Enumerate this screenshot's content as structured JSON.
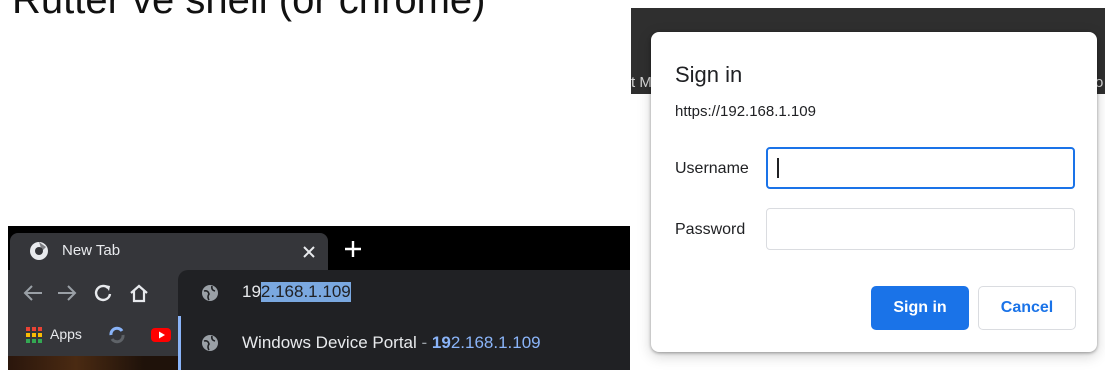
{
  "caption": {
    "text": "Rutter ve shell (or chrome)"
  },
  "browser": {
    "tab": {
      "title": "New Tab",
      "favicon": "chrome-icon",
      "close_icon": "close-icon",
      "new_tab_icon": "plus-icon"
    },
    "toolbar": {
      "icons": [
        "back-arrow-icon",
        "forward-arrow-icon",
        "reload-icon",
        "home-icon"
      ]
    },
    "omnibox": {
      "typed": "19",
      "autocompleted": "2.168.1.109",
      "suggestion": {
        "title": "Windows Device Portal",
        "separator": " - ",
        "match": "19",
        "rest": "2.168.1.109"
      }
    },
    "bookmarks": {
      "apps_label": "Apps",
      "icons": [
        "apps-grid-icon",
        "extension-icon",
        "youtube-icon"
      ]
    }
  },
  "background": {
    "left_text": "t M",
    "right_text": "o"
  },
  "signin": {
    "title": "Sign in",
    "url": "https://192.168.1.109",
    "username_label": "Username",
    "username_value": "",
    "password_label": "Password",
    "password_value": "",
    "sign_in_button": "Sign in",
    "cancel_button": "Cancel"
  },
  "colors": {
    "accent": "#1a73e8",
    "dark_bg": "#202124",
    "toolbar_bg": "#35363a",
    "selection": "#7aa8e0"
  }
}
